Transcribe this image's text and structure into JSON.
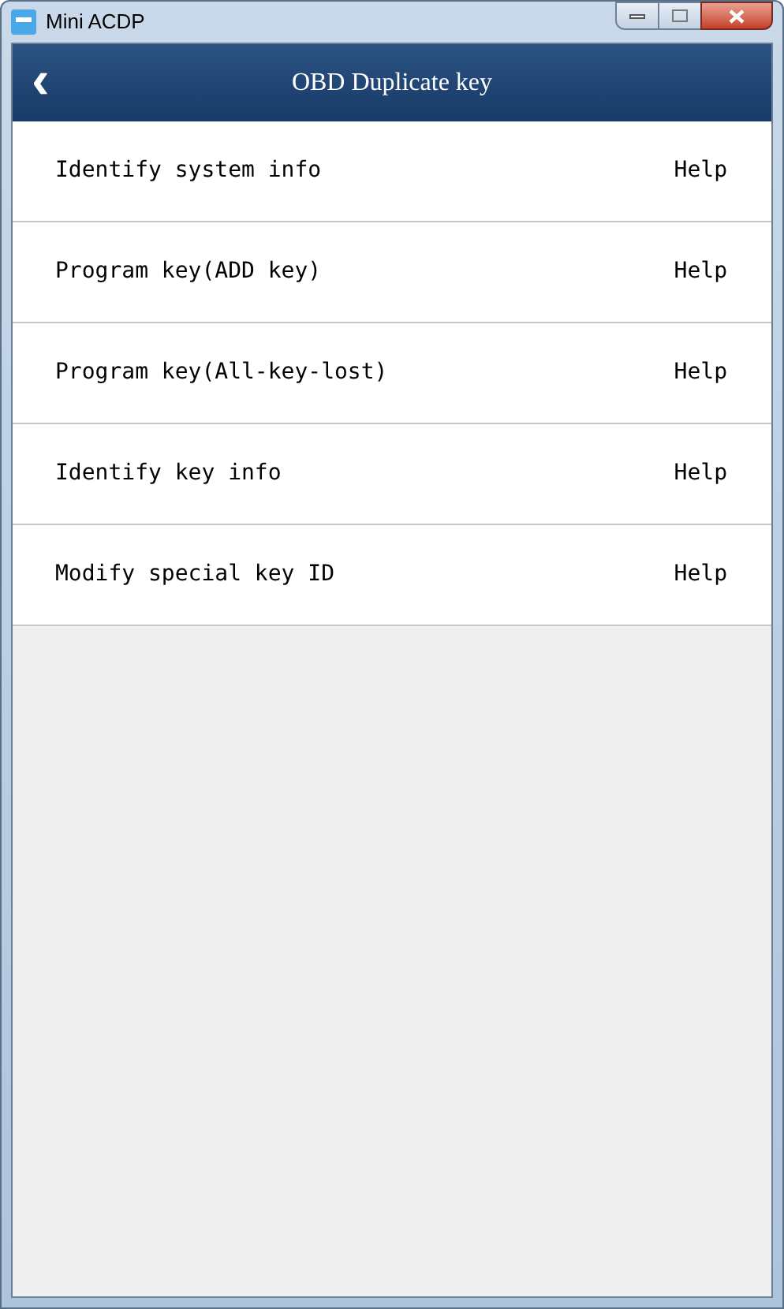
{
  "window": {
    "title": "Mini ACDP"
  },
  "header": {
    "back": "‹",
    "title": "OBD Duplicate key"
  },
  "items": [
    {
      "label": "Identify system info",
      "help": "Help"
    },
    {
      "label": "Program key(ADD key)",
      "help": "Help"
    },
    {
      "label": "Program key(All-key-lost)",
      "help": "Help"
    },
    {
      "label": "Identify key info",
      "help": "Help"
    },
    {
      "label": "Modify special key ID",
      "help": "Help"
    }
  ]
}
